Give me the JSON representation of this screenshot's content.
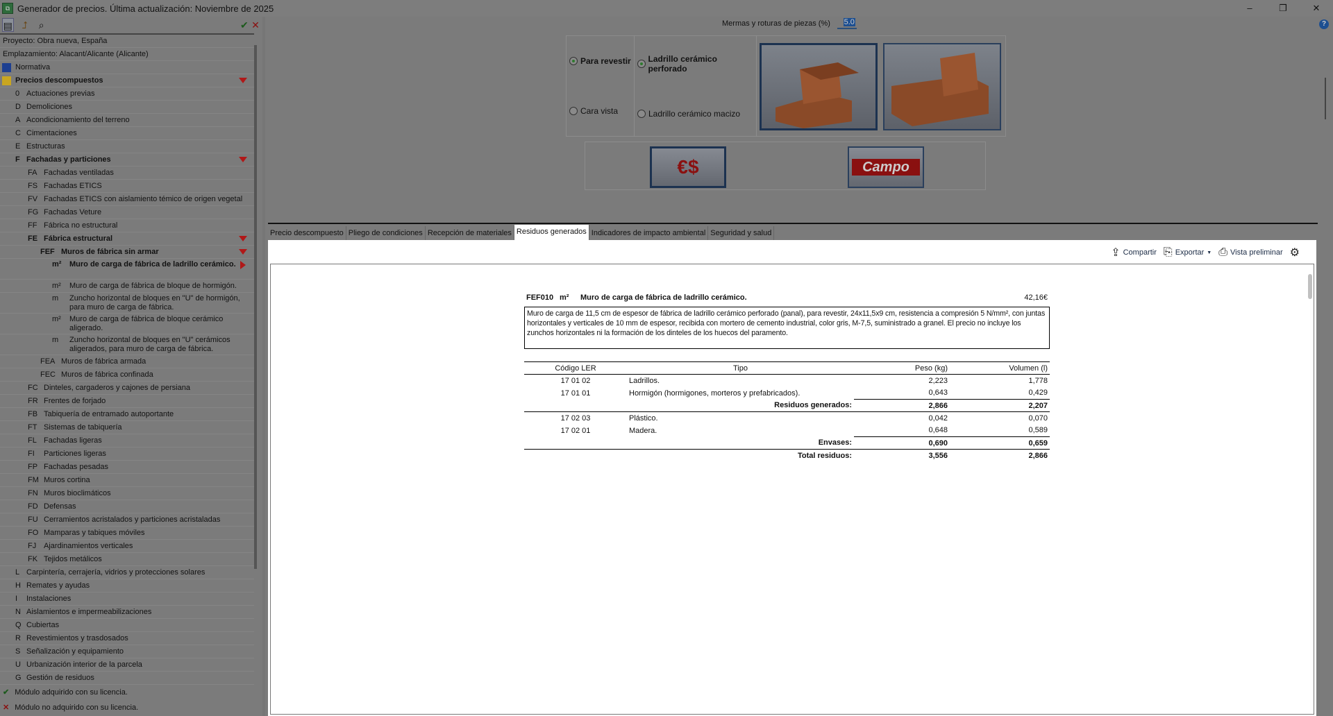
{
  "window": {
    "title": "Generador de precios. Última actualización: Noviembre de 2025",
    "app_icon": "app-icon",
    "minimize": "–",
    "restore": "❐",
    "close": "✕"
  },
  "toolbar": {
    "accept": "✔",
    "cancel": "✕"
  },
  "tree": [
    {
      "code": "",
      "label": "Proyecto: Obra nueva, España",
      "level": -1
    },
    {
      "code": "",
      "label": "Emplazamiento: Alacant/Alicante (Alicante)",
      "level": -1
    },
    {
      "code": "",
      "label": "Normativa",
      "level": -2,
      "icon": "normativa-icon"
    },
    {
      "code": "",
      "label": "Precios descompuestos",
      "level": -2,
      "icon": "prices-icon",
      "bold": true,
      "exp": "down"
    },
    {
      "code": "0",
      "label": "Actuaciones previas",
      "level": 0
    },
    {
      "code": "D",
      "label": "Demoliciones",
      "level": 0
    },
    {
      "code": "A",
      "label": "Acondicionamiento del terreno",
      "level": 0
    },
    {
      "code": "C",
      "label": "Cimentaciones",
      "level": 0
    },
    {
      "code": "E",
      "label": "Estructuras",
      "level": 0
    },
    {
      "code": "F",
      "label": "Fachadas y particiones",
      "level": 0,
      "bold": true,
      "exp": "down"
    },
    {
      "code": "FA",
      "label": "Fachadas ventiladas",
      "level": 1
    },
    {
      "code": "FS",
      "label": "Fachadas ETICS",
      "level": 1
    },
    {
      "code": "FV",
      "label": "Fachadas ETICS con aislamiento témico de origen vegetal",
      "level": 1
    },
    {
      "code": "FG",
      "label": "Fachadas Veture",
      "level": 1
    },
    {
      "code": "FF",
      "label": "Fábrica no estructural",
      "level": 1
    },
    {
      "code": "FE",
      "label": "Fábrica estructural",
      "level": 1,
      "bold": true,
      "exp": "down"
    },
    {
      "code": "FEF",
      "label": "Muros de fábrica sin armar",
      "level": 2,
      "bold": true,
      "exp": "down"
    },
    {
      "code": "m²",
      "label": "Muro de carga de fábrica de ladrillo cerámico.",
      "level": 3,
      "bold": true,
      "exp": "right",
      "two": true
    },
    {
      "code": "m²",
      "label": "Muro de carga de fábrica de bloque de hormigón.",
      "level": 3
    },
    {
      "code": "m",
      "label": "Zuncho horizontal de bloques en \"U\" de hormigón, para muro de carga de fábrica.",
      "level": 3,
      "two": true
    },
    {
      "code": "m²",
      "label": "Muro de carga de fábrica de bloque cerámico aligerado.",
      "level": 3,
      "two": true
    },
    {
      "code": "m",
      "label": "Zuncho horizontal de bloques en \"U\" cerámicos aligerados, para muro de carga de fábrica.",
      "level": 3,
      "two": true
    },
    {
      "code": "FEA",
      "label": "Muros de fábrica armada",
      "level": 2
    },
    {
      "code": "FEC",
      "label": "Muros de fábrica confinada",
      "level": 2
    },
    {
      "code": "FC",
      "label": "Dinteles, cargaderos y cajones de persiana",
      "level": 1
    },
    {
      "code": "FR",
      "label": "Frentes de forjado",
      "level": 1
    },
    {
      "code": "FB",
      "label": "Tabiquería de entramado autoportante",
      "level": 1
    },
    {
      "code": "FT",
      "label": "Sistemas de tabiquería",
      "level": 1
    },
    {
      "code": "FL",
      "label": "Fachadas ligeras",
      "level": 1
    },
    {
      "code": "FI",
      "label": "Particiones ligeras",
      "level": 1
    },
    {
      "code": "FP",
      "label": "Fachadas pesadas",
      "level": 1
    },
    {
      "code": "FM",
      "label": "Muros cortina",
      "level": 1
    },
    {
      "code": "FN",
      "label": "Muros bioclimáticos",
      "level": 1
    },
    {
      "code": "FD",
      "label": "Defensas",
      "level": 1
    },
    {
      "code": "FU",
      "label": "Cerramientos acristalados y particiones acristaladas",
      "level": 1
    },
    {
      "code": "FO",
      "label": "Mamparas y tabiques móviles",
      "level": 1
    },
    {
      "code": "FJ",
      "label": "Ajardinamientos verticales",
      "level": 1
    },
    {
      "code": "FK",
      "label": "Tejidos metálicos",
      "level": 1
    },
    {
      "code": "L",
      "label": "Carpintería, cerrajería, vidrios y protecciones solares",
      "level": 0
    },
    {
      "code": "H",
      "label": "Remates y ayudas",
      "level": 0
    },
    {
      "code": "I",
      "label": "Instalaciones",
      "level": 0
    },
    {
      "code": "N",
      "label": "Aislamientos e impermeabilizaciones",
      "level": 0
    },
    {
      "code": "Q",
      "label": "Cubiertas",
      "level": 0
    },
    {
      "code": "R",
      "label": "Revestimientos y trasdosados",
      "level": 0
    },
    {
      "code": "S",
      "label": "Señalización y equipamiento",
      "level": 0
    },
    {
      "code": "U",
      "label": "Urbanización interior de la parcela",
      "level": 0
    },
    {
      "code": "G",
      "label": "Gestión de residuos",
      "level": 0
    }
  ],
  "legend": {
    "acquired": "Módulo adquirido con su licencia.",
    "not_acquired": "Módulo no adquirido con su licencia."
  },
  "options": {
    "mermas_label": "Mermas y roturas de piezas (%)",
    "mermas_value": "5.0",
    "para_revestir": "Para revestir",
    "cara_vista": "Cara vista",
    "perforado": "Ladrillo cerámico perforado",
    "macizo": "Ladrillo cerámico macizo",
    "campo": "Campo"
  },
  "tabs": [
    "Precio descompuesto",
    "Pliego de condiciones",
    "Recepción de materiales",
    "Residuos generados",
    "Indicadores de impacto ambiental",
    "Seguridad y salud"
  ],
  "doc_tools": {
    "share": "Compartir",
    "export": "Exportar",
    "preview": "Vista preliminar"
  },
  "doc": {
    "code": "FEF010",
    "unit": "m²",
    "title": "Muro de carga de fábrica de ladrillo cerámico.",
    "price": "42,16€",
    "description": "Muro de carga de 11,5 cm de espesor de fábrica de ladrillo cerámico perforado (panal), para revestir, 24x11,5x9 cm, resistencia a compresión 5 N/mm², con juntas horizontales y verticales de 10 mm de espesor, recibida con mortero de cemento industrial, color gris, M-7,5, suministrado a granel. El precio no incluye los zunchos horizontales ni la formación de los dinteles de los huecos del paramento.",
    "headers": [
      "Código LER",
      "Tipo",
      "Peso (kg)",
      "Volumen (l)"
    ],
    "rows": [
      {
        "c": "17 01 02",
        "t": "Ladrillos.",
        "p": "2,223",
        "v": "1,778"
      },
      {
        "c": "17 01 01",
        "t": "Hormigón (hormigones, morteros y prefabricados).",
        "p": "0,643",
        "v": "0,429"
      },
      {
        "sub": true,
        "t": "Residuos generados:",
        "p": "2,866",
        "v": "2,207"
      },
      {
        "c": "17 02 03",
        "t": "Plástico.",
        "p": "0,042",
        "v": "0,070",
        "after": true
      },
      {
        "c": "17 02 01",
        "t": "Madera.",
        "p": "0,648",
        "v": "0,589"
      },
      {
        "sub": true,
        "t": "Envases:",
        "p": "0,690",
        "v": "0,659"
      },
      {
        "sub": true,
        "t": "Total residuos:",
        "p": "3,556",
        "v": "2,866",
        "after": true
      }
    ]
  }
}
